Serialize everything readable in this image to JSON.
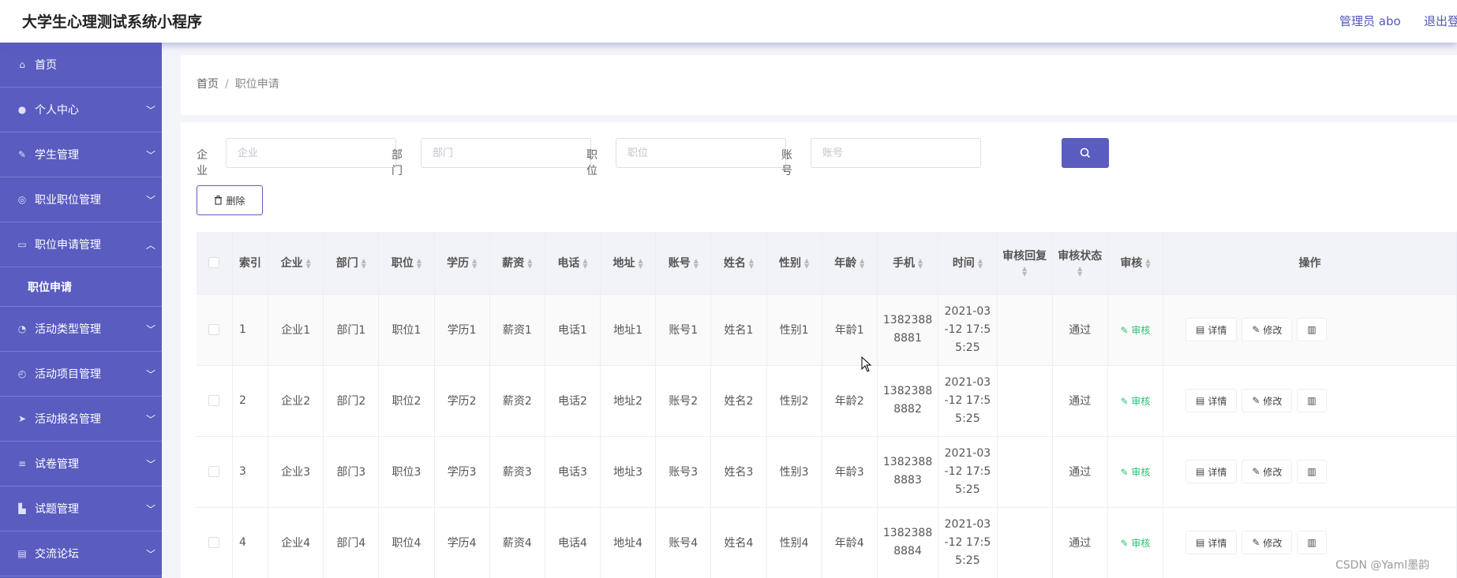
{
  "app": {
    "title": "大学生心理测试系统小程序",
    "admin": "管理员 abo",
    "logout": "退出登录"
  },
  "sidebar": {
    "items": [
      {
        "label": "首页",
        "icon": "home-icon",
        "expandable": false
      },
      {
        "label": "个人中心",
        "icon": "user-icon",
        "expandable": true
      },
      {
        "label": "学生管理",
        "icon": "leaf-icon",
        "expandable": true
      },
      {
        "label": "职业职位管理",
        "icon": "target-icon",
        "expandable": true
      },
      {
        "label": "职位申请管理",
        "icon": "monitor-icon",
        "expandable": true,
        "open": true
      },
      {
        "label": "活动类型管理",
        "icon": "gauge-icon",
        "expandable": true
      },
      {
        "label": "活动项目管理",
        "icon": "compass-icon",
        "expandable": true
      },
      {
        "label": "活动报名管理",
        "icon": "send-icon",
        "expandable": true
      },
      {
        "label": "试卷管理",
        "icon": "list-icon",
        "expandable": true
      },
      {
        "label": "试题管理",
        "icon": "thumb-icon",
        "expandable": true
      },
      {
        "label": "交流论坛",
        "icon": "clipboard-icon",
        "expandable": true
      }
    ],
    "submenu": {
      "label": "职位申请"
    }
  },
  "breadcrumb": {
    "home": "首页",
    "sep": "/",
    "current": "职位申请"
  },
  "search": {
    "fields": [
      {
        "label": "企业",
        "placeholder": "企业"
      },
      {
        "label": "部门",
        "placeholder": "部门"
      },
      {
        "label": "职位",
        "placeholder": "职位"
      },
      {
        "label": "账号",
        "placeholder": "账号"
      }
    ]
  },
  "actions": {
    "delete_label": "删除"
  },
  "table": {
    "headers": [
      "索引",
      "企业",
      "部门",
      "职位",
      "学历",
      "薪资",
      "电话",
      "地址",
      "账号",
      "姓名",
      "性别",
      "年龄",
      "手机",
      "时间",
      "审核回复",
      "审核状态",
      "审核",
      "操作"
    ],
    "rows": [
      {
        "index": "1",
        "company": "企业1",
        "dept": "部门1",
        "position": "职位1",
        "edu": "学历1",
        "salary": "薪资1",
        "tel": "电话1",
        "addr": "地址1",
        "account": "账号1",
        "name": "姓名1",
        "gender": "性别1",
        "age": "年龄1",
        "phone_a": "1382388",
        "phone_b": "8881",
        "time_a": "2021-03",
        "time_b": "-12 17:5",
        "time_c": "5:25",
        "reply": "",
        "status": "通过",
        "audit": "审核"
      },
      {
        "index": "2",
        "company": "企业2",
        "dept": "部门2",
        "position": "职位2",
        "edu": "学历2",
        "salary": "薪资2",
        "tel": "电话2",
        "addr": "地址2",
        "account": "账号2",
        "name": "姓名2",
        "gender": "性别2",
        "age": "年龄2",
        "phone_a": "1382388",
        "phone_b": "8882",
        "time_a": "2021-03",
        "time_b": "-12 17:5",
        "time_c": "5:25",
        "reply": "",
        "status": "通过",
        "audit": "审核"
      },
      {
        "index": "3",
        "company": "企业3",
        "dept": "部门3",
        "position": "职位3",
        "edu": "学历3",
        "salary": "薪资3",
        "tel": "电话3",
        "addr": "地址3",
        "account": "账号3",
        "name": "姓名3",
        "gender": "性别3",
        "age": "年龄3",
        "phone_a": "1382388",
        "phone_b": "8883",
        "time_a": "2021-03",
        "time_b": "-12 17:5",
        "time_c": "5:25",
        "reply": "",
        "status": "通过",
        "audit": "审核"
      },
      {
        "index": "4",
        "company": "企业4",
        "dept": "部门4",
        "position": "职位4",
        "edu": "学历4",
        "salary": "薪资4",
        "tel": "电话4",
        "addr": "地址4",
        "account": "账号4",
        "name": "姓名4",
        "gender": "性别4",
        "age": "年龄4",
        "phone_a": "1382388",
        "phone_b": "8884",
        "time_a": "2021-03",
        "time_b": "-12 17:5",
        "time_c": "5:25",
        "reply": "",
        "status": "通过",
        "audit": "审核"
      }
    ],
    "op_labels": {
      "detail": "详情",
      "edit": "修改"
    }
  },
  "watermark": "CSDN @Yaml墨韵",
  "colors": {
    "accent": "#5a5cc0",
    "audit_green": "#2bbf73"
  }
}
